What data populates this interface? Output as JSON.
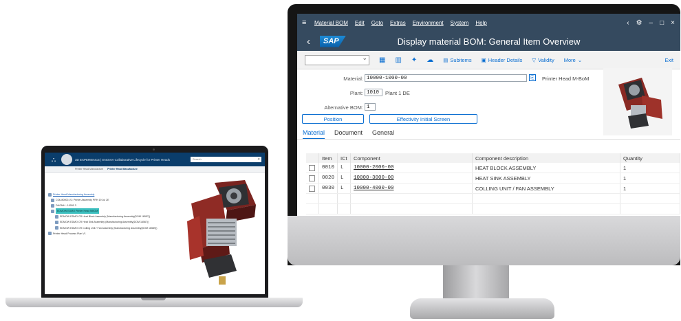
{
  "laptop": {
    "app_bar": {
      "brand": "3D",
      "title": "3D EXPERIENCE | ENOVIA Collaborative Lifecycle for Printer Heads",
      "search_placeholder": "Search"
    },
    "tabs": [
      "Printer Head Manufacture",
      "Printer Head Manufacture"
    ],
    "tree": [
      "Printer Head Manufacturing Assembly",
      "COLM0000-V1: Printer Assembly PRH 19 Jul 2E",
      "DHOMH - 10000 3",
      "EDMOW EDMO Printer Head MBOM",
      "EDMOW EDMO CR Heat Block Assembly (Manufacturing Assembly(DOM 16557))",
      "EDMOW EDMO CR Heat Sink Assembly (Manufacturing Assembly(DOM 16567))",
      "EDMOW EDMO CR Colling Unit / Fan Assembly (Manufacturing Assembly(DOM 16589))",
      "Printer Head Process Plan V1"
    ]
  },
  "sap": {
    "menu": [
      "Material BOM",
      "Edit",
      "Goto",
      "Extras",
      "Environment",
      "System",
      "Help"
    ],
    "logo": "SAP",
    "page_title": "Display material BOM: General Item Overview",
    "toolbar": {
      "subitems": "Subitems",
      "header_details": "Header Details",
      "validity": "Validity",
      "more": "More",
      "exit": "Exit"
    },
    "form": {
      "material_label": "Material:",
      "material_value": "10000-1000-00",
      "material_desc": "Printer Head M-BoM",
      "plant_label": "Plant:",
      "plant_value": "1010",
      "plant_desc": "Plant 1 DE",
      "alt_bom_label": "Alternative BOM:",
      "alt_bom_value": "1"
    },
    "buttons": {
      "position": "Position",
      "effectivity": "Effectivity Initial Screen"
    },
    "tabs": [
      "Material",
      "Document",
      "General"
    ],
    "table": {
      "headers": [
        "Item",
        "ICt",
        "Component",
        "Component description",
        "Quantity"
      ],
      "rows": [
        {
          "item": "0010",
          "ict": "L",
          "component": "10000-2000-00",
          "description": "HEAT BLOCK ASSEMBLY",
          "quantity": "1"
        },
        {
          "item": "0020",
          "ict": "L",
          "component": "10000-3000-00",
          "description": "HEAT SINK ASSEMBLY",
          "quantity": "1"
        },
        {
          "item": "0030",
          "ict": "L",
          "component": "10000-4000-00",
          "description": "COLLING UNIT / FAN ASSEMBLY",
          "quantity": "1"
        }
      ]
    },
    "colors": {
      "shell": "#354a5f",
      "accent": "#0a6ed1",
      "product": "#8a2a24"
    }
  }
}
